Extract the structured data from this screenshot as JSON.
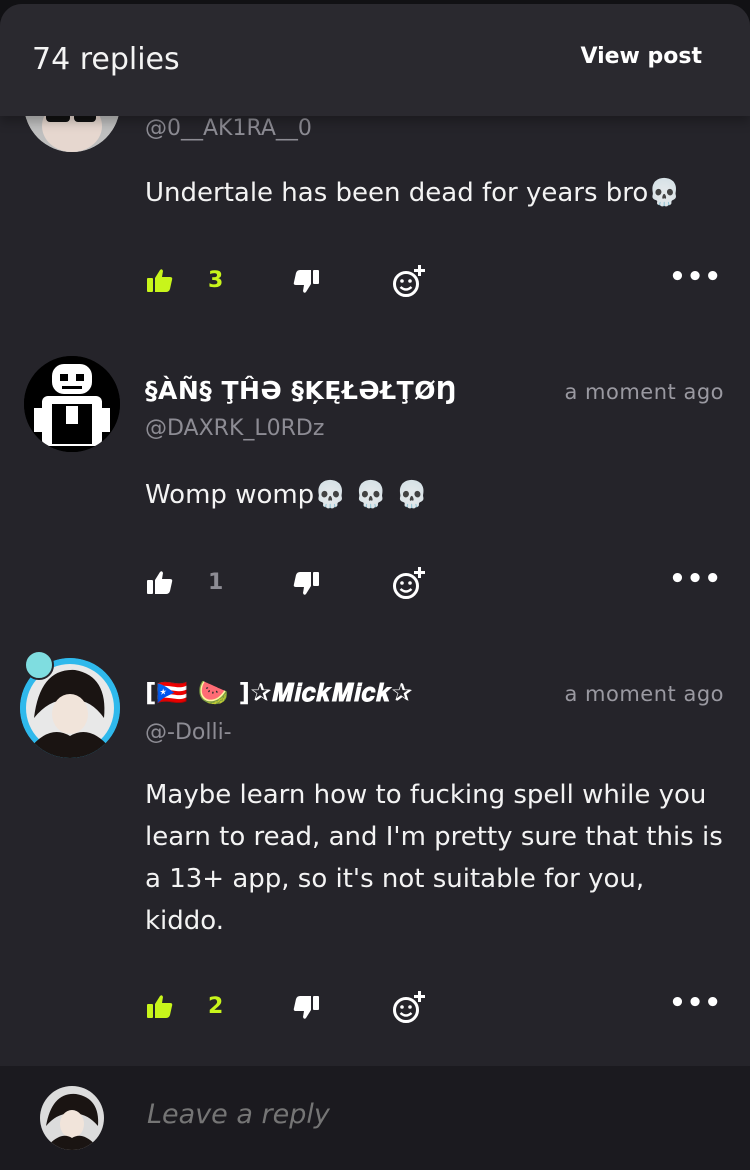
{
  "header": {
    "replies_count": "74 replies",
    "view_post_label": "View post"
  },
  "colors": {
    "accent_green": "#c8f51b",
    "muted": "#8d8c94",
    "background": "#25242a"
  },
  "comments": [
    {
      "handle": "@0__AK1RA__0",
      "body": "Undertale has been dead for years bro💀",
      "likes": "3",
      "liked": true
    },
    {
      "name": "§ÀÑ§ ŢĤƏ §ĶĘŁƏŁŢØŊ",
      "handle": "@DAXRK_L0RDz",
      "time": "a moment ago",
      "body": "Womp womp💀 💀 💀",
      "likes": "1",
      "liked": false
    },
    {
      "name": "[🇵🇷 🍉 ]✰𝑴𝒊𝒄𝒌𝑴𝒊𝒄𝒌✰",
      "handle": "@-Dolli-",
      "time": "a moment ago",
      "body": "Maybe learn how to fucking spell while you learn to read, and I'm pretty sure that this is a 13+ app, so it's not suitable for you, kiddo.",
      "likes": "2",
      "liked": true
    }
  ],
  "icons": {
    "like": "thumbs-up-icon",
    "dislike": "thumbs-down-icon",
    "react": "add-reaction-icon",
    "more": "more-options-icon"
  },
  "more_glyph": "•••",
  "reply": {
    "placeholder": "Leave a reply"
  }
}
